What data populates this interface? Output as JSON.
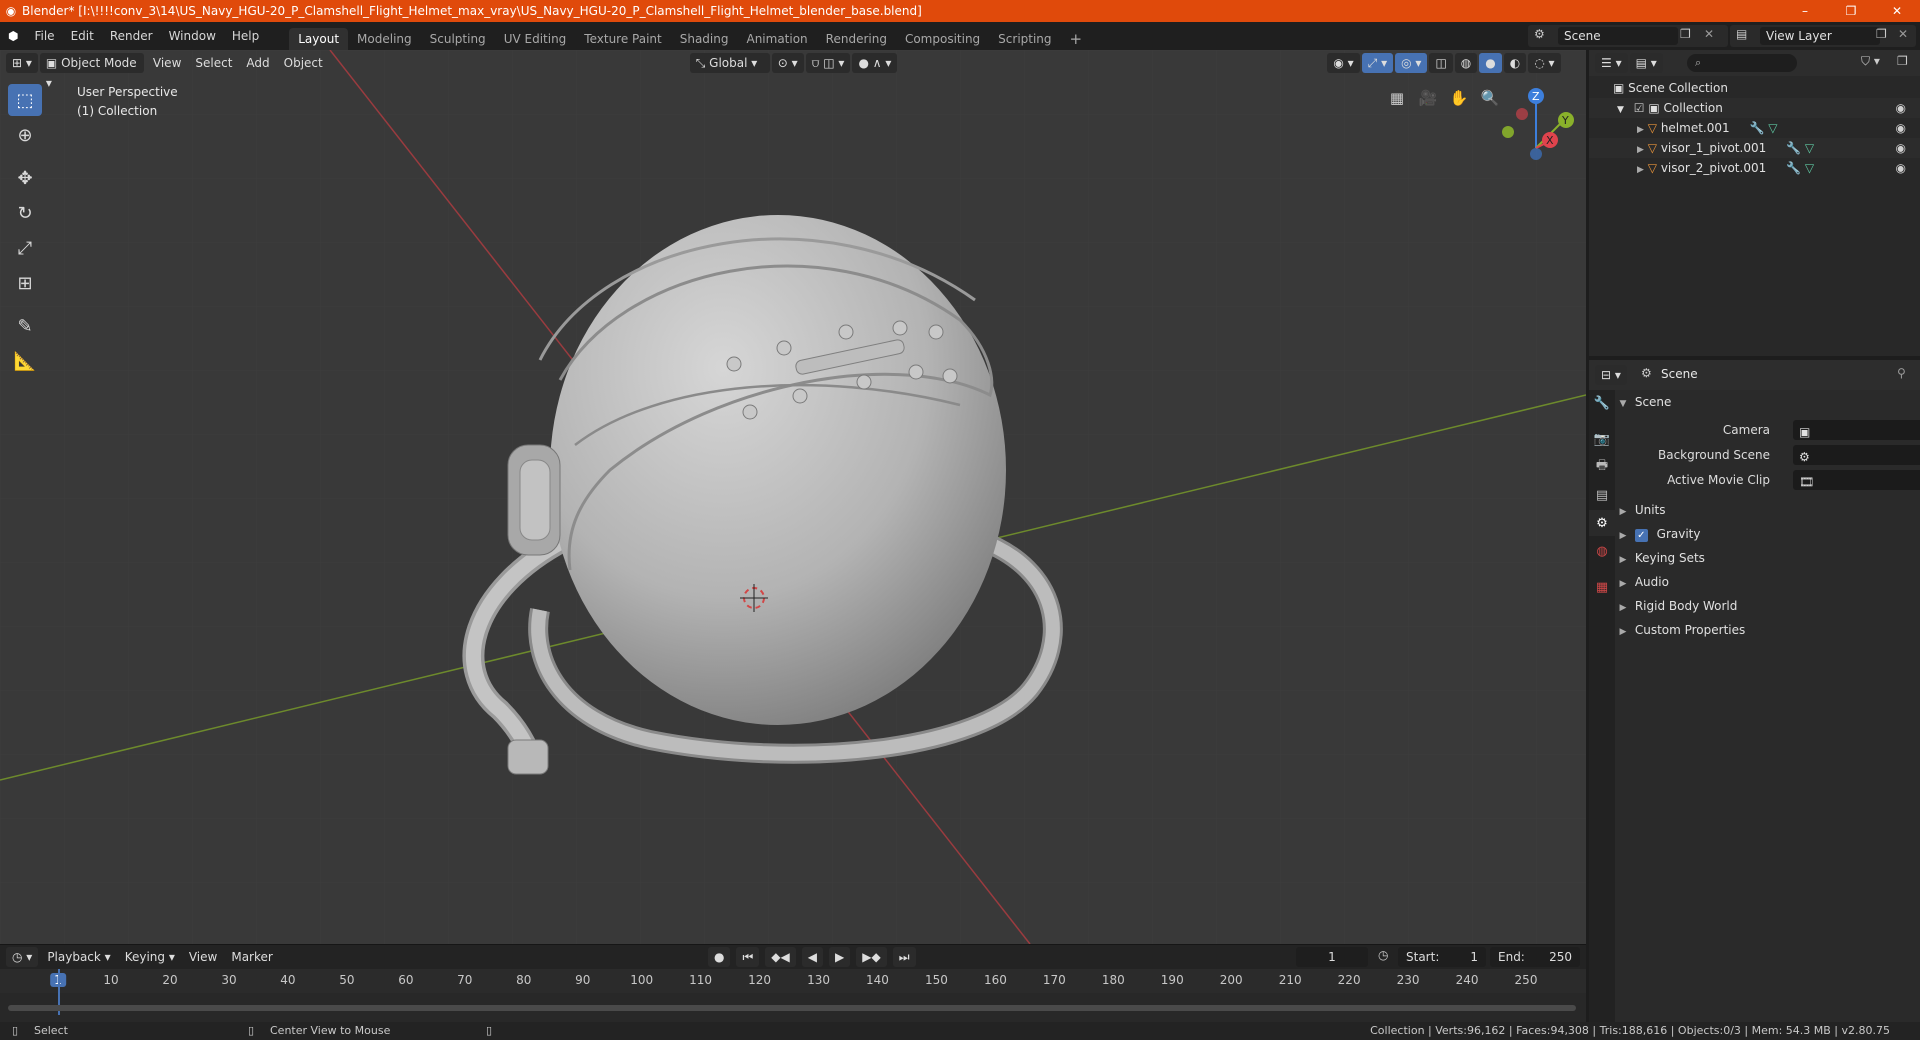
{
  "titlebar": {
    "title": "Blender* [I:\\!!!!conv_3\\14\\US_Navy_HGU-20_P_Clamshell_Flight_Helmet_max_vray\\US_Navy_HGU-20_P_Clamshell_Flight_Helmet_blender_base.blend]",
    "minimize": "–",
    "restore": "❐",
    "close": "✕"
  },
  "menubar": {
    "items": [
      "File",
      "Edit",
      "Render",
      "Window",
      "Help"
    ],
    "workspaces": [
      "Layout",
      "Modeling",
      "Sculpting",
      "UV Editing",
      "Texture Paint",
      "Shading",
      "Animation",
      "Rendering",
      "Compositing",
      "Scripting"
    ],
    "active_workspace": "Layout",
    "add_workspace": "+",
    "scene": "Scene",
    "view_layer": "View Layer"
  },
  "viewport": {
    "mode": "Object Mode",
    "menus": [
      "View",
      "Select",
      "Add",
      "Object"
    ],
    "orientation": "Global",
    "perspective": "User Perspective",
    "collection": "(1) Collection",
    "gizmo": {
      "x": "X",
      "y": "Y",
      "z": "Z"
    }
  },
  "timeline": {
    "menus": [
      "Playback",
      "Keying",
      "View",
      "Marker"
    ],
    "current_frame": "1",
    "start_label": "Start:",
    "start": "1",
    "end_label": "End:",
    "end": "250",
    "ticks": [
      "1",
      "10",
      "20",
      "30",
      "40",
      "50",
      "60",
      "70",
      "80",
      "90",
      "100",
      "110",
      "120",
      "130",
      "140",
      "150",
      "160",
      "170",
      "180",
      "190",
      "200",
      "210",
      "220",
      "230",
      "240",
      "250"
    ]
  },
  "outliner": {
    "root": "Scene Collection",
    "collection": "Collection",
    "objects": [
      "helmet.001",
      "visor_1_pivot.001",
      "visor_2_pivot.001"
    ],
    "search_placeholder": ""
  },
  "properties": {
    "context": "Scene",
    "panel": "Scene",
    "camera_label": "Camera",
    "background_label": "Background Scene",
    "clip_label": "Active Movie Clip",
    "sections": [
      "Units",
      "Gravity",
      "Keying Sets",
      "Audio",
      "Rigid Body World",
      "Custom Properties"
    ]
  },
  "statusbar": {
    "left": "Select",
    "middle": "Center View to Mouse",
    "right": "Collection | Verts:96,162 | Faces:94,308 | Tris:188,616 | Objects:0/3 | Mem: 54.3 MB | v2.80.75"
  },
  "colors": {
    "accent": "#4772b3",
    "titlebar": "#e04a0b",
    "x_axis": "#e0434d",
    "y_axis": "#8ab12b",
    "z_axis": "#3d7fdc"
  }
}
